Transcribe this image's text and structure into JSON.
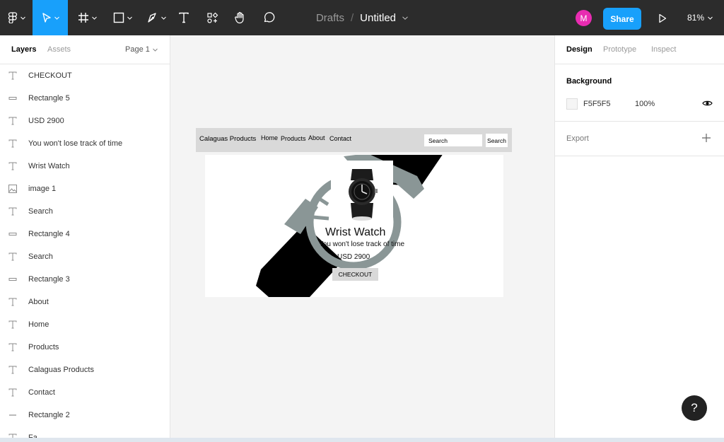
{
  "toolbar": {
    "breadcrumb": "Drafts",
    "slash": "/",
    "file_name": "Untitled",
    "avatar_initial": "M",
    "share_label": "Share",
    "zoom": "81%"
  },
  "left_panel": {
    "tabs": [
      "Layers",
      "Assets"
    ],
    "page": "Page 1",
    "layers": [
      {
        "type": "text",
        "name": "CHECKOUT"
      },
      {
        "type": "rect",
        "name": "Rectangle 5"
      },
      {
        "type": "text",
        "name": "USD 2900"
      },
      {
        "type": "text",
        "name": "You won't lose track of time"
      },
      {
        "type": "text",
        "name": "Wrist Watch"
      },
      {
        "type": "image",
        "name": "image 1"
      },
      {
        "type": "text",
        "name": "Search"
      },
      {
        "type": "rect",
        "name": "Rectangle 4"
      },
      {
        "type": "text",
        "name": "Search"
      },
      {
        "type": "rect",
        "name": "Rectangle 3"
      },
      {
        "type": "text",
        "name": "About"
      },
      {
        "type": "text",
        "name": "Home"
      },
      {
        "type": "text",
        "name": "Products"
      },
      {
        "type": "text",
        "name": "Calaguas Products"
      },
      {
        "type": "text",
        "name": "Contact"
      },
      {
        "type": "line",
        "name": "Rectangle 2"
      },
      {
        "type": "text",
        "name": "Fa"
      }
    ]
  },
  "canvas": {
    "nav": {
      "brand": "Calaguas Products",
      "home": "Home",
      "products": "Products",
      "about": "About",
      "contact": "Contact",
      "search_input": "Search",
      "search_button": "Search"
    },
    "product": {
      "title": "Wrist Watch",
      "subtitle": "You won't lose track of time",
      "price": "USD 2900",
      "button": "CHECKOUT"
    }
  },
  "right_panel": {
    "tabs": [
      "Design",
      "Prototype",
      "Inspect"
    ],
    "background_label": "Background",
    "background_hex": "F5F5F5",
    "background_opacity": "100%",
    "export_label": "Export"
  },
  "help": "?",
  "colors": {
    "accent": "#18a0fb",
    "avatar": "#e82cb1",
    "toolbar": "#2c2c2c"
  }
}
